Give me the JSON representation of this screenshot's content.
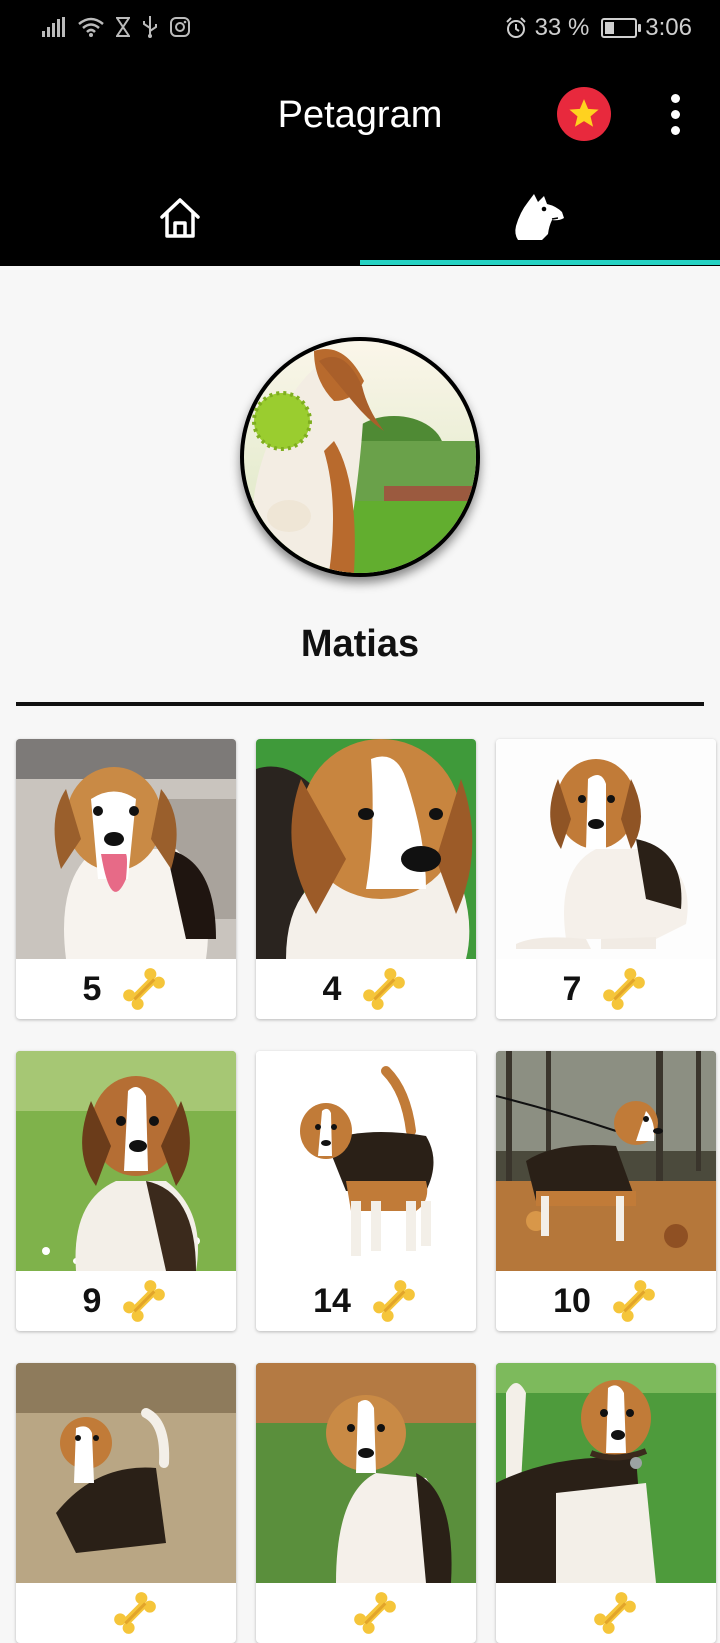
{
  "status_bar": {
    "battery_percent": "33 %",
    "time": "3:06",
    "battery_level": 0.33
  },
  "app_bar": {
    "title": "Petagram",
    "favorites_icon": "star-icon",
    "menu_icon": "more-vertical-icon"
  },
  "tabs": [
    {
      "icon": "home-icon",
      "selected": false
    },
    {
      "icon": "dog-icon",
      "selected": true
    }
  ],
  "colors": {
    "tab_indicator": "#26d2c3",
    "star_button": "#e8293d",
    "bone": "#f5c53a"
  },
  "profile": {
    "name": "Matias"
  },
  "pets": [
    {
      "likes": "5"
    },
    {
      "likes": "4"
    },
    {
      "likes": "7"
    },
    {
      "likes": "9"
    },
    {
      "likes": "14"
    },
    {
      "likes": "10"
    },
    {
      "likes": ""
    },
    {
      "likes": ""
    },
    {
      "likes": ""
    }
  ]
}
